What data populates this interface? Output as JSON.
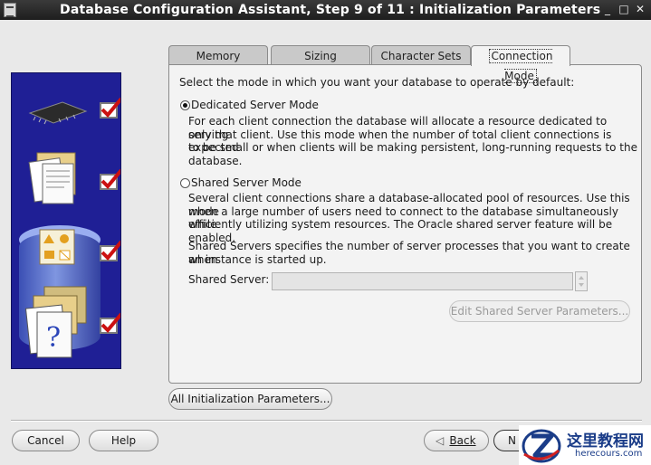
{
  "window": {
    "title": "Database Configuration Assistant, Step 9 of 11 : Initialization Parameters",
    "controls": {
      "minimize": "_",
      "maximize": "□",
      "close": "✕"
    }
  },
  "left_panel": {
    "steps": [
      {
        "icon": "chip-icon",
        "checked": true
      },
      {
        "icon": "folder-documents-icon",
        "checked": true
      },
      {
        "icon": "shapes-icon",
        "checked": true
      },
      {
        "icon": "question-document-icon",
        "checked": true
      }
    ]
  },
  "tabs": [
    {
      "label": "Memory",
      "active": false
    },
    {
      "label": "Sizing",
      "active": false
    },
    {
      "label": "Character Sets",
      "active": false
    },
    {
      "label": "Connection Mode",
      "active": true
    }
  ],
  "connection_mode": {
    "intro": "Select the mode in which you want your database to operate by default:",
    "dedicated": {
      "label": "Dedicated Server Mode",
      "selected": true,
      "desc": [
        "For each client connection the database will allocate a resource dedicated to serving",
        "only that client.  Use this mode when the number of total client connections is expected",
        "to be small or when clients will be making persistent, long-running requests to the",
        "database."
      ]
    },
    "shared": {
      "label": "Shared Server Mode",
      "selected": false,
      "desc": [
        "Several client connections share a database-allocated pool of resources.  Use this mode",
        "when a large number of users need to connect to the database simultaneously while",
        "efficiently utilizing system resources.  The Oracle shared server feature will be enabled."
      ]
    },
    "shared_servers_desc": [
      "Shared Servers specifies the number of server processes that you want to create when",
      "an instance is started up."
    ],
    "shared_server_label": "Shared Server:",
    "shared_server_value": "",
    "edit_button": "Edit Shared Server Parameters..."
  },
  "all_params_button": "All Initialization Parameters...",
  "footer": {
    "cancel": "Cancel",
    "help": "Help",
    "back": "Back",
    "next_partial": "N"
  },
  "watermark": {
    "title": "这里教程网",
    "url": "herecours.com"
  },
  "colors": {
    "titlebar": "#2a2a2a",
    "panel_blue": "#1f1f95",
    "check_red": "#cc1111",
    "watermark_blue": "#1a3c88"
  }
}
